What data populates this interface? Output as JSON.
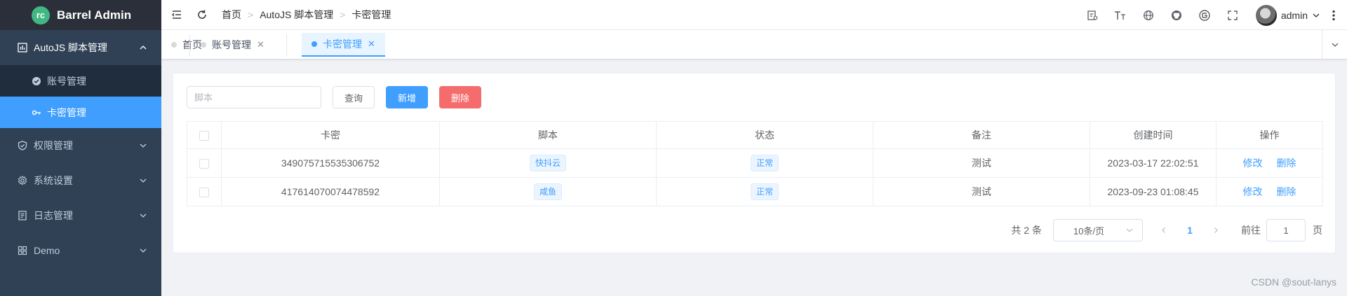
{
  "app": {
    "title": "Barrel Admin",
    "logo_glyph": "rc"
  },
  "sidebar": {
    "items": [
      {
        "label": "AutoJS 脚本管理",
        "icon": "chart-icon",
        "open": true,
        "children": [
          {
            "label": "账号管理",
            "icon": "account-icon",
            "active": false
          },
          {
            "label": "卡密管理",
            "icon": "key-icon",
            "active": true
          }
        ]
      },
      {
        "label": "权限管理",
        "icon": "shield-icon"
      },
      {
        "label": "系统设置",
        "icon": "gear-icon"
      },
      {
        "label": "日志管理",
        "icon": "log-icon"
      },
      {
        "label": "Demo",
        "icon": "grid-icon"
      }
    ]
  },
  "navbar": {
    "breadcrumb": [
      "首页",
      "AutoJS 脚本管理",
      "卡密管理"
    ],
    "tools": [
      "screenshot-icon",
      "font-size-icon",
      "language-icon",
      "github-icon",
      "gitee-icon",
      "fullscreen-icon"
    ],
    "user": "admin"
  },
  "tabs": [
    {
      "label": "首页",
      "closable": false,
      "active": false
    },
    {
      "label": "账号管理",
      "closable": true,
      "active": false
    },
    {
      "label": "卡密管理",
      "closable": true,
      "active": true
    }
  ],
  "toolbar": {
    "search_placeholder": "脚本",
    "query_label": "查询",
    "add_label": "新增",
    "delete_label": "删除"
  },
  "table": {
    "columns": [
      "卡密",
      "脚本",
      "状态",
      "备注",
      "创建时间",
      "操作"
    ],
    "rows": [
      {
        "card": "349075715535306752",
        "script": "快抖云",
        "status": "正常",
        "remark": "测试",
        "created": "2023-03-17 22:02:51"
      },
      {
        "card": "417614070074478592",
        "script": "咸鱼",
        "status": "正常",
        "remark": "测试",
        "created": "2023-09-23 01:08:45"
      }
    ],
    "edit_label": "修改",
    "delete_label": "删除"
  },
  "pagination": {
    "total_text": "共 2 条",
    "page_size": "10条/页",
    "current_page": "1",
    "goto_label": "前往",
    "goto_value": "1",
    "page_unit": "页"
  },
  "watermark": "CSDN @sout-lanys",
  "colors": {
    "primary": "#409eff",
    "danger": "#f56c6c",
    "sidebar_bg": "#304156",
    "sidebar_active": "#409eff"
  }
}
